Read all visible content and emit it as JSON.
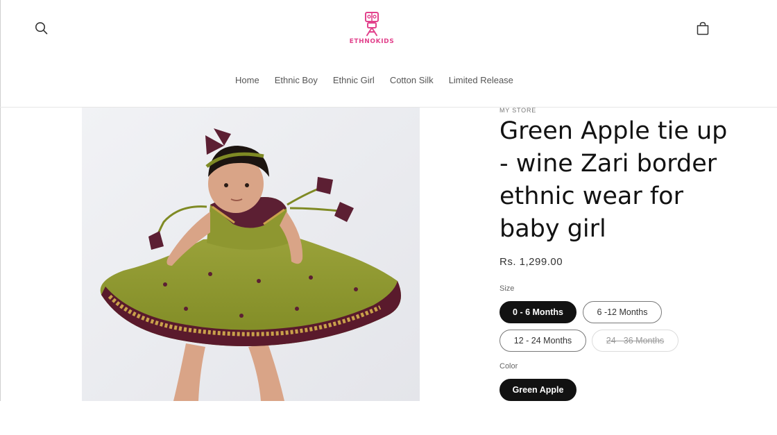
{
  "header": {
    "logo_text": "ETHNOKIDS",
    "brand_color": "#e2428c",
    "search_icon": "search-icon",
    "cart_icon": "bag-icon"
  },
  "nav": {
    "items": [
      {
        "label": "Home"
      },
      {
        "label": "Ethnic Boy"
      },
      {
        "label": "Ethnic Girl"
      },
      {
        "label": "Cotton Silk"
      },
      {
        "label": "Limited Release"
      }
    ]
  },
  "product": {
    "vendor": "MY STORE",
    "title": "Green Apple tie up - wine Zari border ethnic wear for baby girl",
    "price": "Rs. 1,299.00",
    "image_alt": "Baby girl in green apple dress with wine zari border",
    "size": {
      "label": "Size",
      "options": [
        {
          "label": "0 - 6 Months",
          "state": "selected"
        },
        {
          "label": "6 -12 Months",
          "state": "available"
        },
        {
          "label": "12 - 24 Months",
          "state": "available"
        },
        {
          "label": "24 - 36 Months",
          "state": "sold-out"
        }
      ]
    },
    "color": {
      "label": "Color",
      "options": [
        {
          "label": "Green Apple",
          "state": "selected"
        }
      ]
    }
  }
}
